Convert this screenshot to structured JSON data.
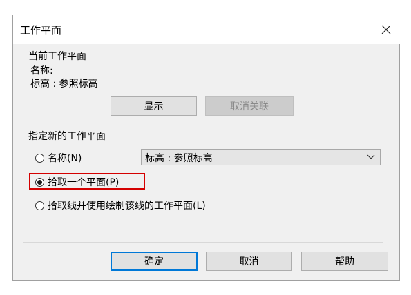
{
  "window": {
    "title": "工作平面"
  },
  "current_plane": {
    "legend": "当前工作平面",
    "name_label": "名称:",
    "name_value": "标高 : 参照标高",
    "show_button": "显示",
    "dissociate_button": "取消关联"
  },
  "specify_new": {
    "legend": "指定新的工作平面",
    "options": [
      {
        "label": "名称(N)",
        "checked": false
      },
      {
        "label": "拾取一个平面(P)",
        "checked": true
      },
      {
        "label": "拾取线并使用绘制该线的工作平面(L)",
        "checked": false
      }
    ],
    "name_select_value": "标高 : 参照标高"
  },
  "footer": {
    "ok": "确定",
    "cancel": "取消",
    "help": "帮助"
  },
  "colors": {
    "highlight": "#d40000",
    "default_button_border": "#0078d7"
  },
  "icons": {
    "close": "close-icon",
    "dropdown": "chevron-down-icon"
  }
}
